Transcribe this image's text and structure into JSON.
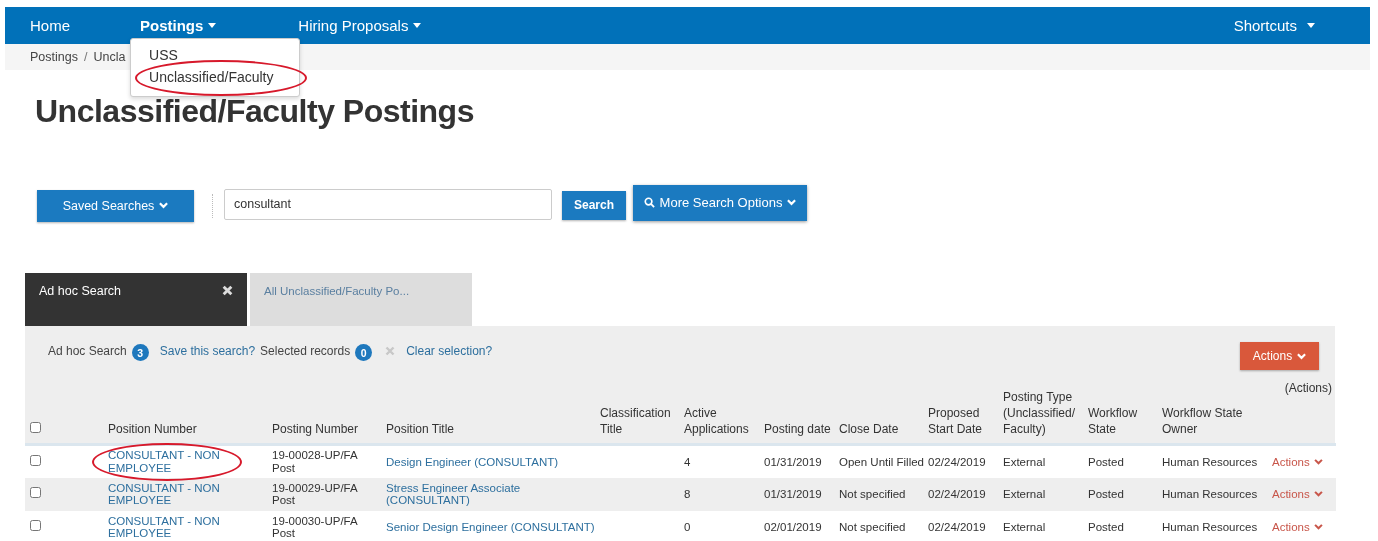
{
  "nav": {
    "items": [
      {
        "label": "Home",
        "has_menu": false,
        "selected": false
      },
      {
        "label": "Postings",
        "has_menu": true,
        "selected": true,
        "menu": [
          {
            "label": "USS",
            "circled": false
          },
          {
            "label": "Unclassified/Faculty",
            "circled": true
          }
        ]
      },
      {
        "label": "Hiring Proposals",
        "has_menu": true,
        "selected": false
      }
    ],
    "shortcuts": "Shortcuts"
  },
  "breadcrumb": {
    "separator": "/",
    "items": [
      "Postings",
      "Uncla"
    ]
  },
  "page_title": "Unclassified/Faculty Postings",
  "search": {
    "saved_searches": "Saved Searches",
    "value": "consultant",
    "button": "Search",
    "more_options": "More Search Options"
  },
  "tabs": [
    {
      "label": "Ad hoc Search",
      "selected": true,
      "closable": true
    },
    {
      "label": "All Unclassified/Faculty Po...",
      "selected": false,
      "closable": false
    }
  ],
  "toolbar": {
    "search_label": "Ad hoc Search",
    "search_count": "3",
    "save_link": "Save this search?",
    "selected_label": "Selected records",
    "selected_count": "0",
    "clear_link": "Clear selection?",
    "actions_button": "Actions"
  },
  "table": {
    "select_all_checked": false,
    "columns": [
      "Position Number",
      "Posting Number",
      "Position Title",
      "Classification Title",
      "Active Applications",
      "Posting date",
      "Close Date",
      "Proposed Start Date",
      "Posting Type (Unclassified/Faculty)",
      "Workflow State",
      "Workflow State Owner",
      "(Actions)"
    ],
    "rows": [
      {
        "checked": false,
        "circled": true,
        "cells": [
          "CONSULTANT - NON EMPLOYEE",
          "19-00028-UP/FA Post",
          "Design Engineer (CONSULTANT)",
          "",
          "4",
          "01/31/2019",
          "Open Until Filled",
          "02/24/2019",
          "External",
          "Posted",
          "Human Resources",
          "Actions"
        ]
      },
      {
        "checked": false,
        "circled": false,
        "cells": [
          "CONSULTANT - NON EMPLOYEE",
          "19-00029-UP/FA Post",
          "Stress Engineer Associate (CONSULTANT)",
          "",
          "8",
          "01/31/2019",
          "Not specified",
          "02/24/2019",
          "External",
          "Posted",
          "Human Resources",
          "Actions"
        ]
      },
      {
        "checked": false,
        "circled": false,
        "cells": [
          "CONSULTANT - NON EMPLOYEE",
          "19-00030-UP/FA Post",
          "Senior Design Engineer (CONSULTANT)",
          "",
          "0",
          "02/01/2019",
          "Not specified",
          "02/24/2019",
          "External",
          "Posted",
          "Human Resources",
          "Actions"
        ]
      }
    ]
  }
}
